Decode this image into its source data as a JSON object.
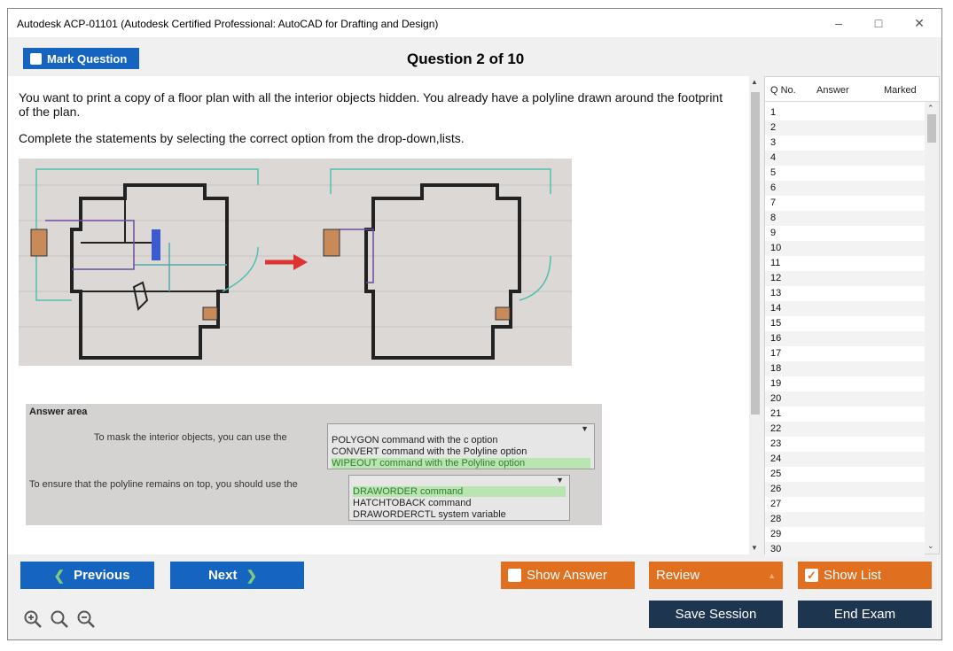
{
  "window": {
    "title": "Autodesk ACP-01101 (Autodesk Certified Professional: AutoCAD for Drafting and Design)",
    "minimize_icon": "minimize-icon",
    "maximize_icon": "maximize-icon",
    "close_icon": "close-icon"
  },
  "header": {
    "mark_question_label": "Mark Question",
    "question_title": "Question 2 of 10"
  },
  "question": {
    "text1": "You want to print a copy of a floor plan with all the interior objects hidden. You already have a polyline drawn around the footprint of the plan.",
    "text2": "Complete the statements by selecting the correct option from the drop-down,lists."
  },
  "answer_area": {
    "heading": "Answer area",
    "statement1": "To mask the interior objects, you can use the",
    "options1": [
      "POLYGON command with the c option",
      "CONVERT command with the Polyline option",
      "WIPEOUT command with the Polyline option"
    ],
    "statement2": "To ensure that the polyline remains on top, you should use the",
    "options2": [
      "DRAWORDER command",
      "HATCHTOBACK command",
      "DRAWORDERCTL system variable"
    ]
  },
  "qlist": {
    "col_qno": "Q No.",
    "col_answer": "Answer",
    "col_marked": "Marked",
    "numbers": [
      "1",
      "2",
      "3",
      "4",
      "5",
      "6",
      "7",
      "8",
      "9",
      "10",
      "11",
      "12",
      "13",
      "14",
      "15",
      "16",
      "17",
      "18",
      "19",
      "20",
      "21",
      "22",
      "23",
      "24",
      "25",
      "26",
      "27",
      "28",
      "29",
      "30"
    ]
  },
  "footer": {
    "previous_label": "Previous",
    "next_label": "Next",
    "show_answer_label": "Show Answer",
    "review_label": "Review",
    "show_list_label": "Show List",
    "save_session_label": "Save Session",
    "end_exam_label": "End Exam"
  },
  "colors": {
    "primary_blue": "#1565c0",
    "orange": "#e0701f",
    "navy": "#1e3550",
    "selected_option": "#2e7d32"
  }
}
